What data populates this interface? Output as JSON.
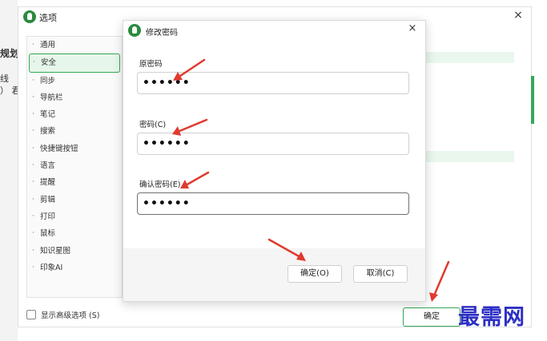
{
  "background_window": {
    "partial_texts": [
      "规划",
      "线",
      "）  君"
    ]
  },
  "options_window": {
    "title": "选项",
    "close_label": "×",
    "sidebar_items": [
      {
        "label": "通用"
      },
      {
        "label": "安全",
        "active": true
      },
      {
        "label": "同步"
      },
      {
        "label": "导航栏"
      },
      {
        "label": "笔记"
      },
      {
        "label": "搜索"
      },
      {
        "label": "快捷键按钮"
      },
      {
        "label": "语言"
      },
      {
        "label": "提醒"
      },
      {
        "label": "剪辑"
      },
      {
        "label": "打印"
      },
      {
        "label": "鼠标"
      },
      {
        "label": "知识星图"
      },
      {
        "label": "印象AI"
      }
    ],
    "bullet": "·",
    "show_advanced_label": "显示高级选项 (S)",
    "ok_label": "确定",
    "accent_color": "#33a853"
  },
  "change_password_dialog": {
    "title": "修改密码",
    "close_label": "×",
    "fields": [
      {
        "label": "原密码",
        "value": "••••••"
      },
      {
        "label": "密码(C)",
        "value": "••••••"
      },
      {
        "label": "确认密码(E)",
        "value": "••••••",
        "focused": true
      }
    ],
    "ok_label": "确定(O)",
    "cancel_label": "取消(C)"
  },
  "annotation_color": "#e03a2f",
  "watermark": "最需网"
}
